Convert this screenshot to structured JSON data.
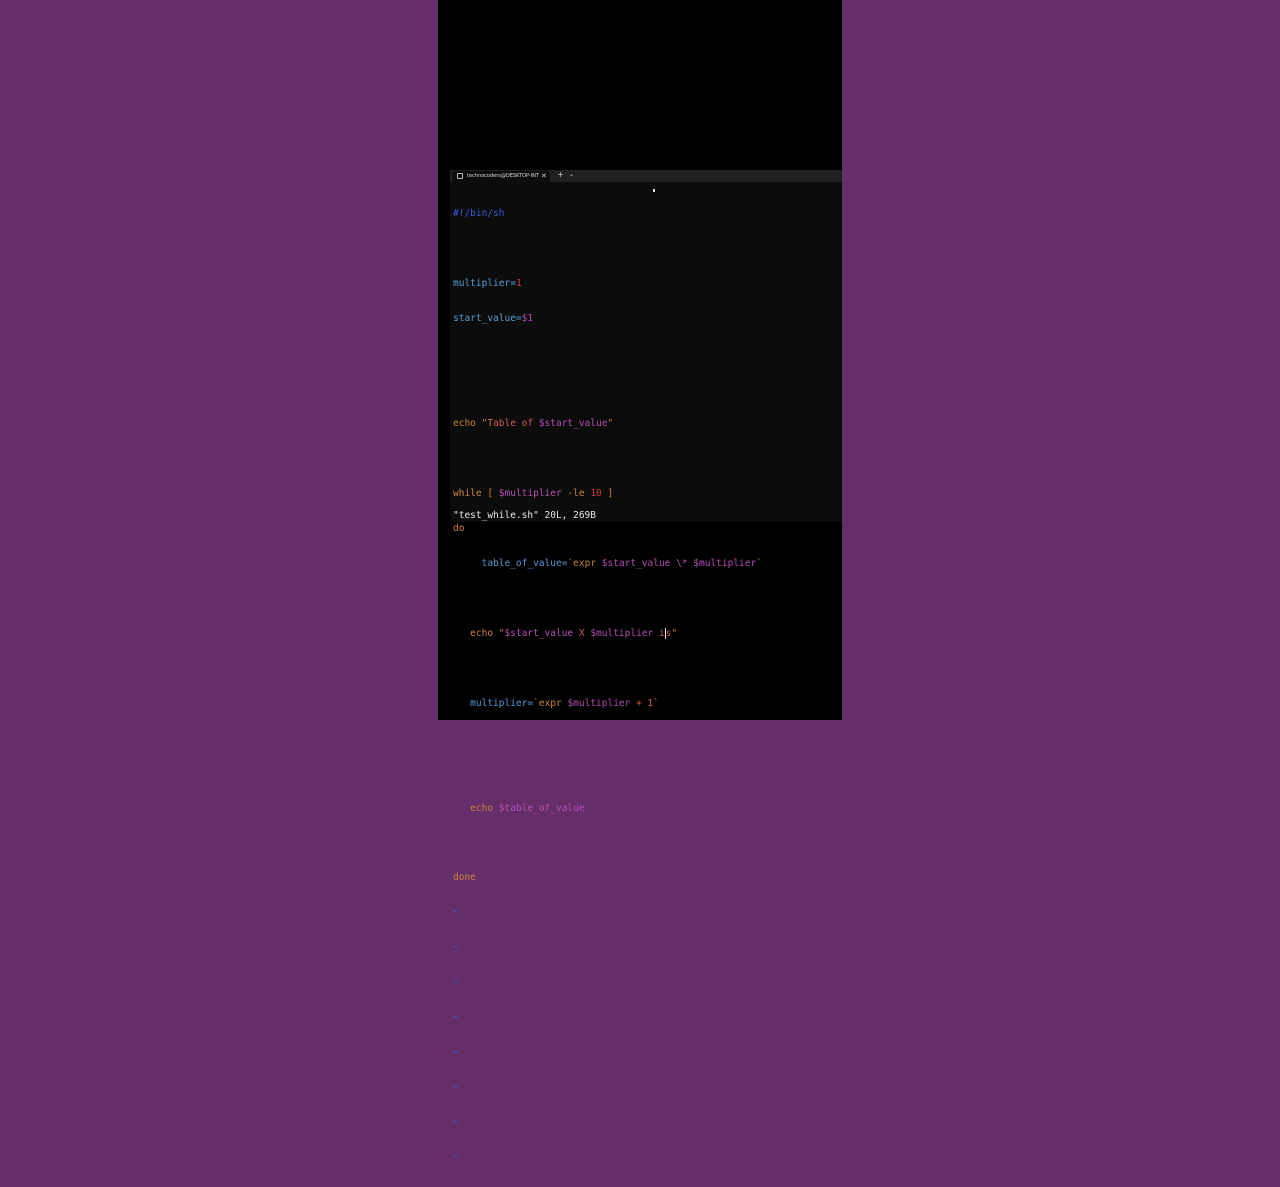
{
  "terminal": {
    "tab_title": "technocoders@DESKTOP-INT",
    "tab_close": "✕",
    "new_tab": "+",
    "dropdown": "⌄"
  },
  "code": {
    "shebang": "#!/bin/sh",
    "l_mult_name": "multiplier",
    "l_mult_eq": "=",
    "l_mult_val": "1",
    "l_start_name": "start_value",
    "l_start_eq": "=",
    "l_start_val": "$1",
    "echo1_kw": "echo ",
    "echo1_q1": "\"",
    "echo1_text": "Table of ",
    "echo1_var": "$start_value",
    "echo1_q2": "\"",
    "while_kw": "while",
    "while_b1": " [ ",
    "while_var": "$multiplier",
    "while_op": " -le ",
    "while_num": "10",
    "while_b2": " ]",
    "do_kw": "do",
    "t_indent": "     ",
    "t_name": "table_of_value",
    "t_eq": "=",
    "t_bt1": "`",
    "t_expr": "expr ",
    "t_var1": "$start_value",
    "t_mul": " \\* ",
    "t_var2": "$multiplier",
    "t_bt2": "`",
    "e2_indent": "   ",
    "e2_kw": "echo ",
    "e2_q1": "\"",
    "e2_var1": "$start_value",
    "e2_x": " X ",
    "e2_var2": "$multiplier",
    "e2_sp": " ",
    "e2_before": "i",
    "e2_after": "s",
    "e2_q2": "\"",
    "m_indent": "   ",
    "m_name": "multiplier",
    "m_eq": "=",
    "m_bt1": "`",
    "m_expr": "expr ",
    "m_var": "$multiplier",
    "m_plus": " + 1",
    "m_bt2": "`",
    "e3_indent": "   ",
    "e3_kw": "echo ",
    "e3_var": "$table_of_value",
    "done_kw": "done",
    "tilde": "~"
  },
  "status_line": "\"test_while.sh\" 20L, 269B",
  "colors": {
    "background": "#652d69",
    "terminal_bg": "#0c0c0c",
    "variable": "#569cd6",
    "keyword": "#c9853c",
    "dollar_var": "#b34fb3",
    "string_number": "#d13b3b"
  }
}
